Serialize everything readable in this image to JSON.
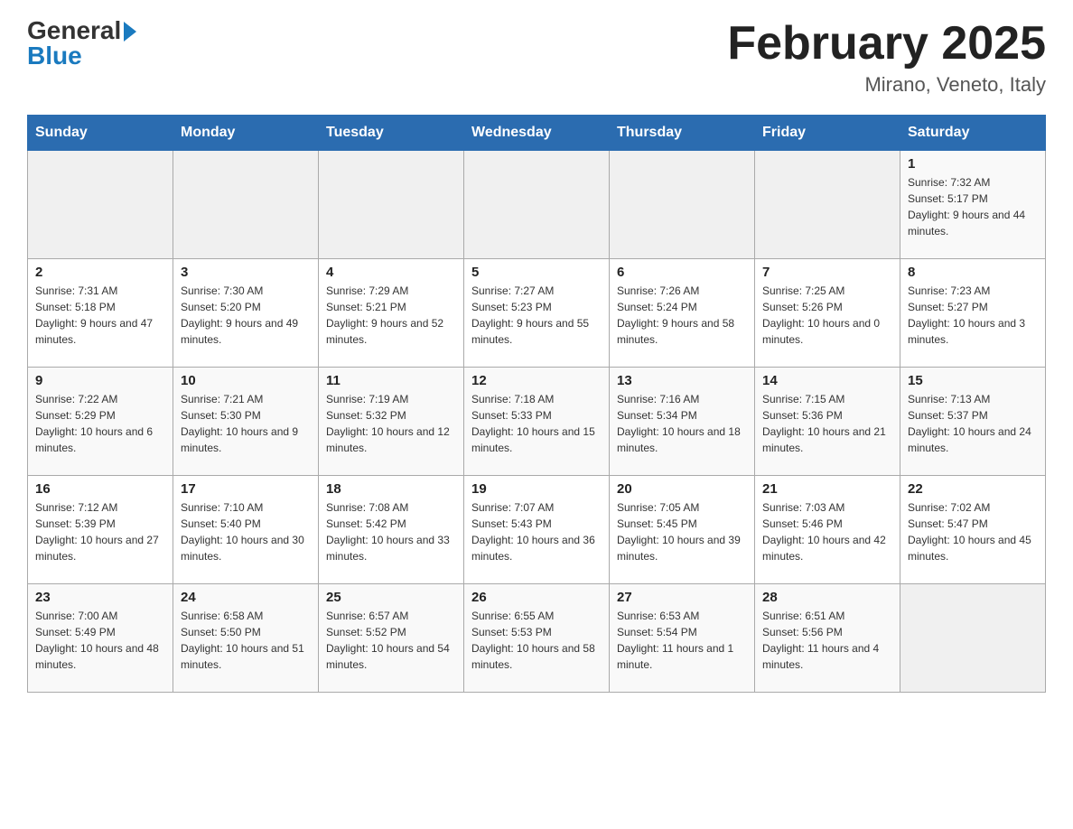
{
  "logo": {
    "general": "General",
    "blue": "Blue"
  },
  "header": {
    "title": "February 2025",
    "location": "Mirano, Veneto, Italy"
  },
  "days_of_week": [
    "Sunday",
    "Monday",
    "Tuesday",
    "Wednesday",
    "Thursday",
    "Friday",
    "Saturday"
  ],
  "weeks": [
    [
      {
        "day": "",
        "info": ""
      },
      {
        "day": "",
        "info": ""
      },
      {
        "day": "",
        "info": ""
      },
      {
        "day": "",
        "info": ""
      },
      {
        "day": "",
        "info": ""
      },
      {
        "day": "",
        "info": ""
      },
      {
        "day": "1",
        "info": "Sunrise: 7:32 AM\nSunset: 5:17 PM\nDaylight: 9 hours and 44 minutes."
      }
    ],
    [
      {
        "day": "2",
        "info": "Sunrise: 7:31 AM\nSunset: 5:18 PM\nDaylight: 9 hours and 47 minutes."
      },
      {
        "day": "3",
        "info": "Sunrise: 7:30 AM\nSunset: 5:20 PM\nDaylight: 9 hours and 49 minutes."
      },
      {
        "day": "4",
        "info": "Sunrise: 7:29 AM\nSunset: 5:21 PM\nDaylight: 9 hours and 52 minutes."
      },
      {
        "day": "5",
        "info": "Sunrise: 7:27 AM\nSunset: 5:23 PM\nDaylight: 9 hours and 55 minutes."
      },
      {
        "day": "6",
        "info": "Sunrise: 7:26 AM\nSunset: 5:24 PM\nDaylight: 9 hours and 58 minutes."
      },
      {
        "day": "7",
        "info": "Sunrise: 7:25 AM\nSunset: 5:26 PM\nDaylight: 10 hours and 0 minutes."
      },
      {
        "day": "8",
        "info": "Sunrise: 7:23 AM\nSunset: 5:27 PM\nDaylight: 10 hours and 3 minutes."
      }
    ],
    [
      {
        "day": "9",
        "info": "Sunrise: 7:22 AM\nSunset: 5:29 PM\nDaylight: 10 hours and 6 minutes."
      },
      {
        "day": "10",
        "info": "Sunrise: 7:21 AM\nSunset: 5:30 PM\nDaylight: 10 hours and 9 minutes."
      },
      {
        "day": "11",
        "info": "Sunrise: 7:19 AM\nSunset: 5:32 PM\nDaylight: 10 hours and 12 minutes."
      },
      {
        "day": "12",
        "info": "Sunrise: 7:18 AM\nSunset: 5:33 PM\nDaylight: 10 hours and 15 minutes."
      },
      {
        "day": "13",
        "info": "Sunrise: 7:16 AM\nSunset: 5:34 PM\nDaylight: 10 hours and 18 minutes."
      },
      {
        "day": "14",
        "info": "Sunrise: 7:15 AM\nSunset: 5:36 PM\nDaylight: 10 hours and 21 minutes."
      },
      {
        "day": "15",
        "info": "Sunrise: 7:13 AM\nSunset: 5:37 PM\nDaylight: 10 hours and 24 minutes."
      }
    ],
    [
      {
        "day": "16",
        "info": "Sunrise: 7:12 AM\nSunset: 5:39 PM\nDaylight: 10 hours and 27 minutes."
      },
      {
        "day": "17",
        "info": "Sunrise: 7:10 AM\nSunset: 5:40 PM\nDaylight: 10 hours and 30 minutes."
      },
      {
        "day": "18",
        "info": "Sunrise: 7:08 AM\nSunset: 5:42 PM\nDaylight: 10 hours and 33 minutes."
      },
      {
        "day": "19",
        "info": "Sunrise: 7:07 AM\nSunset: 5:43 PM\nDaylight: 10 hours and 36 minutes."
      },
      {
        "day": "20",
        "info": "Sunrise: 7:05 AM\nSunset: 5:45 PM\nDaylight: 10 hours and 39 minutes."
      },
      {
        "day": "21",
        "info": "Sunrise: 7:03 AM\nSunset: 5:46 PM\nDaylight: 10 hours and 42 minutes."
      },
      {
        "day": "22",
        "info": "Sunrise: 7:02 AM\nSunset: 5:47 PM\nDaylight: 10 hours and 45 minutes."
      }
    ],
    [
      {
        "day": "23",
        "info": "Sunrise: 7:00 AM\nSunset: 5:49 PM\nDaylight: 10 hours and 48 minutes."
      },
      {
        "day": "24",
        "info": "Sunrise: 6:58 AM\nSunset: 5:50 PM\nDaylight: 10 hours and 51 minutes."
      },
      {
        "day": "25",
        "info": "Sunrise: 6:57 AM\nSunset: 5:52 PM\nDaylight: 10 hours and 54 minutes."
      },
      {
        "day": "26",
        "info": "Sunrise: 6:55 AM\nSunset: 5:53 PM\nDaylight: 10 hours and 58 minutes."
      },
      {
        "day": "27",
        "info": "Sunrise: 6:53 AM\nSunset: 5:54 PM\nDaylight: 11 hours and 1 minute."
      },
      {
        "day": "28",
        "info": "Sunrise: 6:51 AM\nSunset: 5:56 PM\nDaylight: 11 hours and 4 minutes."
      },
      {
        "day": "",
        "info": ""
      }
    ]
  ]
}
